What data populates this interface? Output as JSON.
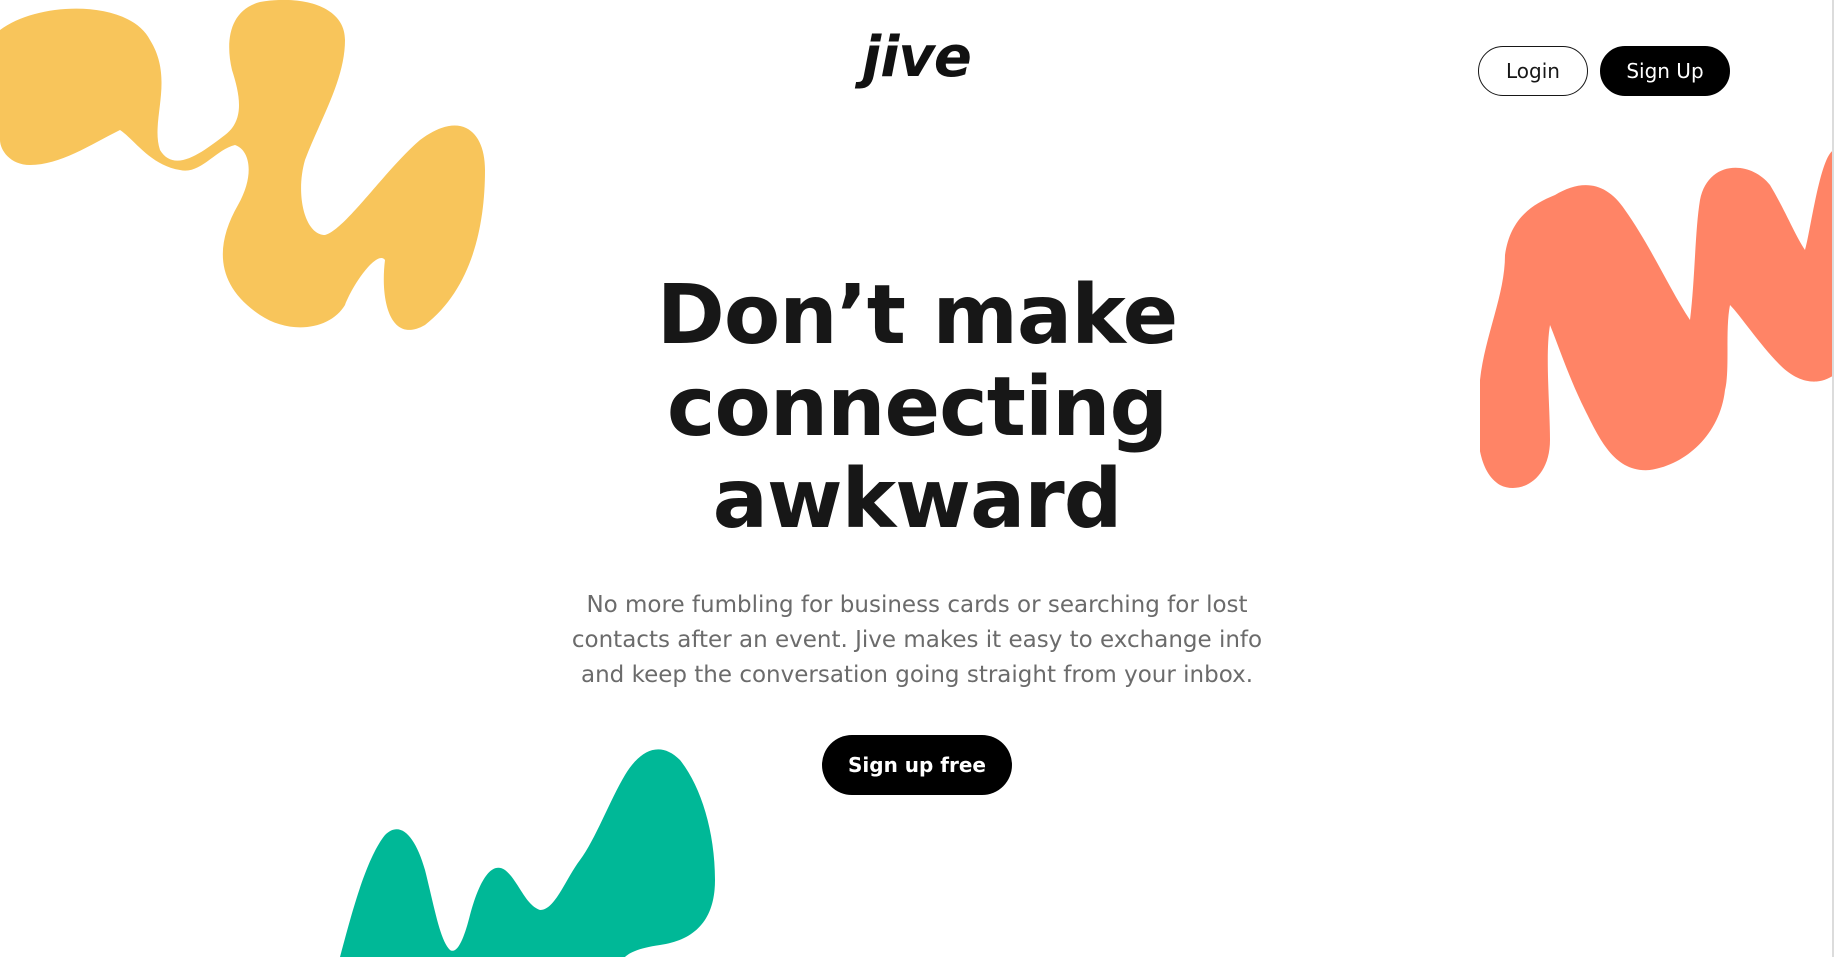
{
  "brand": {
    "logo_text": "jive"
  },
  "nav": {
    "login_label": "Login",
    "signup_label": "Sign Up"
  },
  "hero": {
    "title_lines": [
      "Don’t make",
      "connecting",
      "awkward"
    ],
    "subtitle": "No more fumbling for business cards or searching for lost contacts after an event. Jive makes it easy to exchange info and keep the conversation going straight from your inbox.",
    "cta_label": "Sign up free"
  },
  "decor": {
    "yellow": "#F8C55B",
    "coral": "#FF8466",
    "green": "#00B897"
  }
}
